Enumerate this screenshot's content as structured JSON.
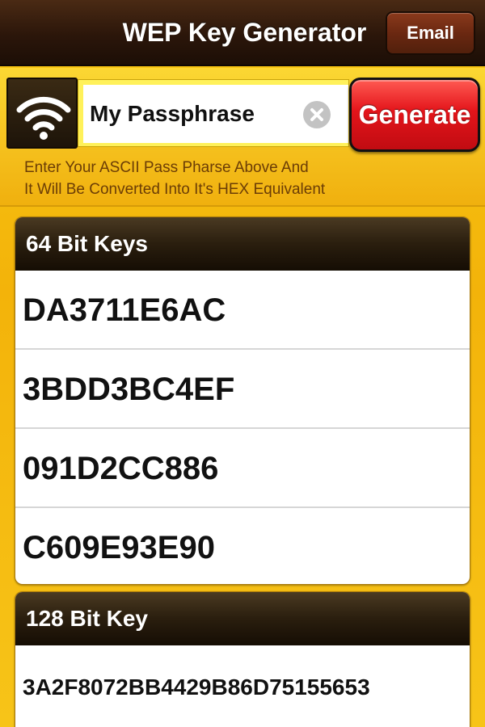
{
  "navbar": {
    "title": "WEP Key Generator",
    "email_label": "Email"
  },
  "input": {
    "value": "My Passphrase",
    "generate_label": "Generate",
    "instructions_line1": "Enter Your ASCII Pass Pharse Above And",
    "instructions_line2": "It Will Be Converted Into It's HEX Equivalent"
  },
  "keys64": {
    "header": "64 Bit Keys",
    "items": [
      "DA3711E6AC",
      "3BDD3BC4EF",
      "091D2CC886",
      "C609E93E90"
    ]
  },
  "keys128": {
    "header": "128 Bit Key",
    "value": "3A2F8072BB4429B86D75155653"
  },
  "icons": {
    "wifi": "wifi-icon",
    "clear": "clear-icon"
  },
  "colors": {
    "accent_red": "#e3141a",
    "brand_gold": "#f3b30a",
    "nav_brown": "#2b160a"
  }
}
